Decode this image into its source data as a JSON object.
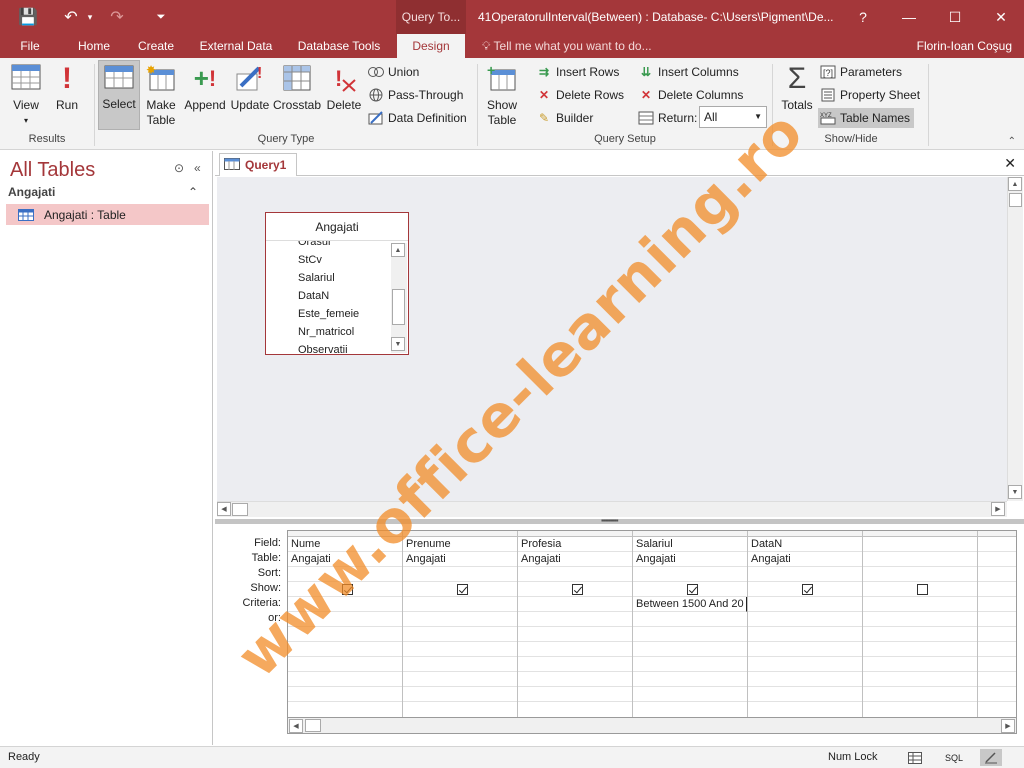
{
  "titlebar": {
    "context_tab": "Query To...",
    "title": "41OperatorulInterval(Between) : Database- C:\\Users\\Pigment\\De...",
    "help": "?",
    "minimize": "—",
    "maximize": "☐",
    "close": "✕",
    "save_icon": "💾",
    "undo_icon": "↶",
    "redo_icon": "↷",
    "qat_more": "⏷"
  },
  "tabs": {
    "file": "File",
    "home": "Home",
    "create": "Create",
    "external_data": "External Data",
    "database_tools": "Database Tools",
    "design": "Design",
    "tell_me": "Tell me what you want to do...",
    "user": "Florin-Ioan Coşug"
  },
  "ribbon": {
    "results": {
      "label": "Results",
      "view": "View",
      "run": "Run"
    },
    "query_type": {
      "label": "Query Type",
      "select": "Select",
      "make_table_1": "Make",
      "make_table_2": "Table",
      "append": "Append",
      "update": "Update",
      "crosstab": "Crosstab",
      "delete": "Delete",
      "union": "Union",
      "pass_through": "Pass-Through",
      "data_definition": "Data Definition"
    },
    "query_setup": {
      "label": "Query Setup",
      "show_table_1": "Show",
      "show_table_2": "Table",
      "insert_rows": "Insert Rows",
      "delete_rows": "Delete Rows",
      "builder": "Builder",
      "insert_columns": "Insert Columns",
      "delete_columns": "Delete Columns",
      "return_label": "Return:",
      "return_value": "All"
    },
    "show_hide": {
      "label": "Show/Hide",
      "totals": "Totals",
      "parameters": "Parameters",
      "property_sheet": "Property Sheet",
      "table_names": "Table Names"
    }
  },
  "navpane": {
    "title": "All Tables",
    "group": "Angajati",
    "item": "Angajati : Table"
  },
  "doc": {
    "tab_label": "Query1",
    "close": "✕"
  },
  "fieldlist": {
    "table": "Angajati",
    "fields": [
      "Orasul",
      "StCv",
      "Salariul",
      "DataN",
      "Este_femeie",
      "Nr_matricol",
      "Observatii"
    ]
  },
  "grid": {
    "row_labels": [
      "Field:",
      "Table:",
      "Sort:",
      "Show:",
      "Criteria:",
      "or:"
    ],
    "columns": [
      {
        "field": "Nume",
        "table": "Angajati",
        "sort": "",
        "show": true,
        "criteria": "",
        "or": ""
      },
      {
        "field": "Prenume",
        "table": "Angajati",
        "sort": "",
        "show": true,
        "criteria": "",
        "or": ""
      },
      {
        "field": "Profesia",
        "table": "Angajati",
        "sort": "",
        "show": true,
        "criteria": "",
        "or": ""
      },
      {
        "field": "Salariul",
        "table": "Angajati",
        "sort": "",
        "show": true,
        "criteria": "Between 1500 And 20",
        "or": ""
      },
      {
        "field": "DataN",
        "table": "Angajati",
        "sort": "",
        "show": true,
        "criteria": "",
        "or": ""
      },
      {
        "field": "",
        "table": "",
        "sort": "",
        "show": false,
        "criteria": "",
        "or": ""
      },
      {
        "field": "",
        "table": "",
        "sort": "",
        "show": false,
        "criteria": "",
        "or": ""
      }
    ]
  },
  "status": {
    "ready": "Ready",
    "num_lock": "Num Lock",
    "sql": "SQL"
  },
  "watermark": "www.office-learning.ro",
  "colors": {
    "accent": "#a4373a",
    "selected_item": "#f4c7c8",
    "watermark": "#f28c28"
  }
}
